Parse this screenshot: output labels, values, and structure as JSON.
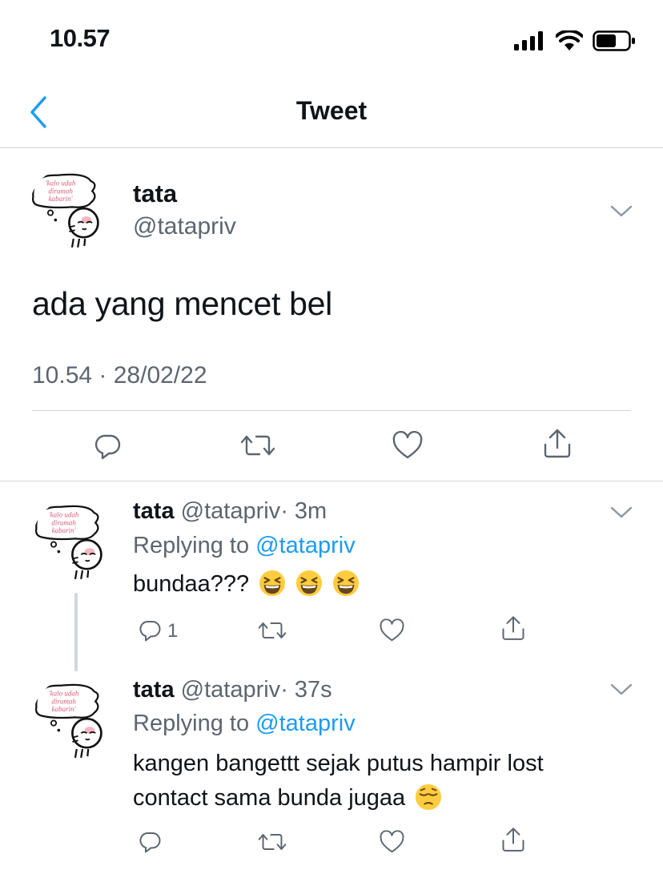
{
  "status_bar": {
    "time": "10.57",
    "icons": [
      "signal-icon",
      "wifi-icon",
      "battery-icon"
    ]
  },
  "nav": {
    "title": "Tweet",
    "back_icon": "chevron-left-icon"
  },
  "main_tweet": {
    "author_name": "tata",
    "author_handle": "@tatapriv",
    "avatar_text": [
      "'kalo udah",
      "dirumah",
      "kabarin'"
    ],
    "text": "ada yang mencet bel",
    "meta": "10.54 · 28/02/22",
    "actions": [
      "reply-icon",
      "retweet-icon",
      "like-icon",
      "share-icon"
    ]
  },
  "replies": [
    {
      "author_name": "tata",
      "author_handle": "@tatapriv",
      "time": "· 3m",
      "replying_prefix": "Replying to ",
      "replying_to": "@tatapriv",
      "text": "bundaa???",
      "emojis": [
        "grinning-squinting-face",
        "grinning-squinting-face",
        "grinning-squinting-face"
      ],
      "reply_count": "1"
    },
    {
      "author_name": "tata",
      "author_handle": "@tatapriv",
      "time": "· 37s",
      "replying_prefix": "Replying to ",
      "replying_to": "@tatapriv",
      "text_line1": "kangen bangettt sejak putus hampir lost",
      "text_line2": "contact sama bunda jugaa",
      "emojis": [
        "pensive-face"
      ]
    }
  ],
  "colors": {
    "accent": "#1d9bf0",
    "secondary_text": "#5b6670",
    "divider": "#d3d7db"
  }
}
